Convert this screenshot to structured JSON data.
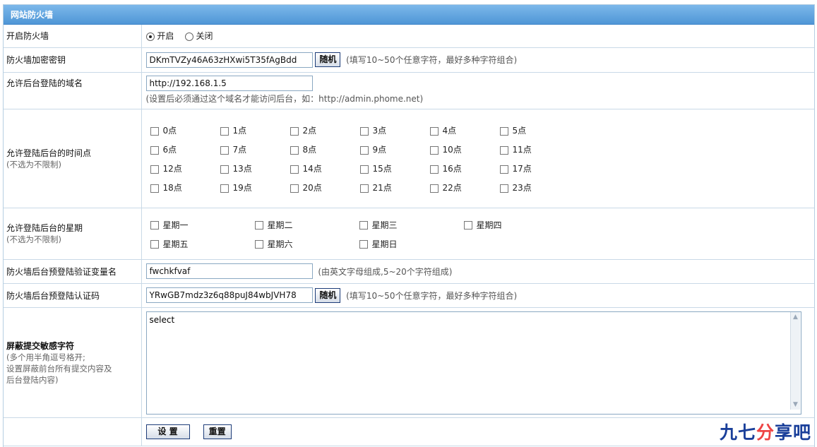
{
  "panel": {
    "title": "网站防火墙"
  },
  "rows": {
    "firewall_enable": {
      "label": "开启防火墙",
      "options": [
        {
          "label": "开启",
          "selected": true
        },
        {
          "label": "关闭",
          "selected": false
        }
      ]
    },
    "encrypt_key": {
      "label": "防火墙加密密钥",
      "value": "DKmTVZy46A63zHXwi5T35fAgBdd",
      "random_label": "随机",
      "hint": "(填写10~50个任意字符，最好多种字符组合)"
    },
    "allowed_domain": {
      "label": "允许后台登陆的域名",
      "value": "http://192.168.1.5",
      "hint": "(设置后必须通过这个域名才能访问后台，如：http://admin.phome.net)"
    },
    "allowed_hours": {
      "label": "允许登陆后台的时间点",
      "sublabel": "(不选为不限制)",
      "hours": [
        "0点",
        "1点",
        "2点",
        "3点",
        "4点",
        "5点",
        "6点",
        "7点",
        "8点",
        "9点",
        "10点",
        "11点",
        "12点",
        "13点",
        "14点",
        "15点",
        "16点",
        "17点",
        "18点",
        "19点",
        "20点",
        "21点",
        "22点",
        "23点"
      ]
    },
    "allowed_days": {
      "label": "允许登陆后台的星期",
      "sublabel": "(不选为不限制)",
      "days": [
        "星期一",
        "星期二",
        "星期三",
        "星期四",
        "星期五",
        "星期六",
        "星期日"
      ]
    },
    "verify_var": {
      "label": "防火墙后台预登陆验证变量名",
      "value": "fwchkfvaf",
      "hint": "(由英文字母组成,5~20个字符组成)"
    },
    "verify_code": {
      "label": "防火墙后台预登陆认证码",
      "value": "YRwGB7mdz3z6q88puJ84wbJVH78",
      "random_label": "随机",
      "hint": "(填写10~50个任意字符，最好多种字符组合)"
    },
    "sensitive": {
      "label": "屏蔽提交敏感字符",
      "sub_lines": [
        "(多个用半角逗号格开;",
        "设置屏蔽前台所有提交内容及",
        "后台登陆内容)"
      ],
      "value": "select"
    }
  },
  "actions": {
    "submit_label": "设 置",
    "reset_label": "重置"
  },
  "watermark": {
    "text_blue": "九七",
    "text_red": "分",
    "text_blue2": "享吧"
  }
}
